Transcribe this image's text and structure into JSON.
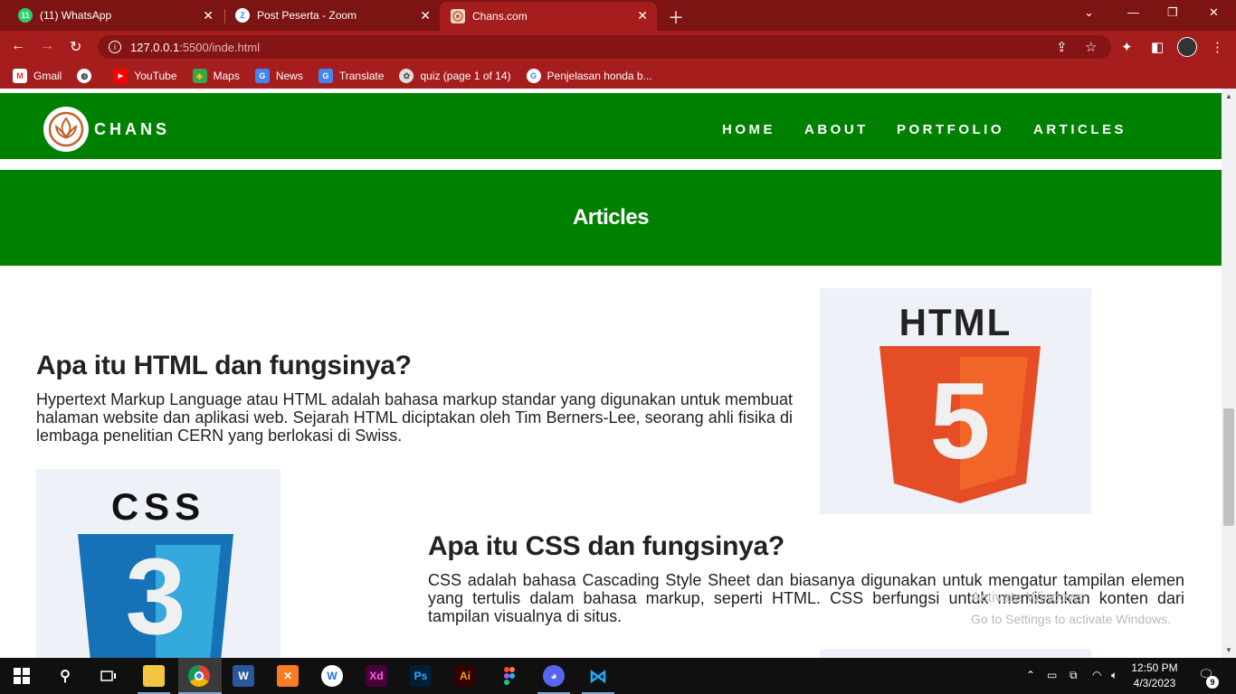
{
  "browser": {
    "tabs": [
      {
        "title": "(11) WhatsApp",
        "badge": "11"
      },
      {
        "title": "Post Peserta - Zoom",
        "icon_letter": "Z"
      },
      {
        "title": "Chans.com"
      }
    ],
    "url_host": "127.0.0.1",
    "url_path": ":5500/inde.html",
    "bookmarks": [
      {
        "label": "Gmail",
        "icon": "gmail-icon"
      },
      {
        "label": "",
        "icon": "globe-icon"
      },
      {
        "label": "YouTube",
        "icon": "youtube-icon"
      },
      {
        "label": "Maps",
        "icon": "maps-icon"
      },
      {
        "label": "News",
        "icon": "news-icon"
      },
      {
        "label": "Translate",
        "icon": "translate-icon"
      },
      {
        "label": "quiz (page 1 of 14)",
        "icon": "quiz-icon"
      },
      {
        "label": "Penjelasan honda b...",
        "icon": "google-icon"
      }
    ],
    "theme_color": "#a61d1d"
  },
  "site": {
    "brand": "CHANS",
    "menu": [
      "HOME",
      "ABOUT",
      "PORTFOLIO",
      "ARTICLES"
    ],
    "hero_title": "Articles",
    "accent_color": "#008000",
    "articles": [
      {
        "title": "Apa itu HTML dan fungsinya?",
        "text": "Hypertext Markup Language atau HTML adalah bahasa markup standar yang digunakan untuk membuat halaman website dan aplikasi web. Sejarah HTML diciptakan oleh Tim Berners-Lee, seorang ahli fisika di lembaga penelitian CERN yang berlokasi di Swiss.",
        "image_label": "HTML",
        "image_number": "5"
      },
      {
        "title": "Apa itu CSS dan fungsinya?",
        "text": "CSS adalah bahasa Cascading Style Sheet dan biasanya digunakan untuk mengatur tampilan elemen yang tertulis dalam bahasa markup, seperti HTML. CSS berfungsi untuk memisahkan konten dari tampilan visualnya di situs.",
        "image_label": "CSS",
        "image_number": "3"
      }
    ]
  },
  "watermark": {
    "line1": "Activate Windows",
    "line2": "Go to Settings to activate Windows."
  },
  "taskbar": {
    "apps": [
      "start-icon",
      "search-icon",
      "task-view-icon",
      "file-explorer-icon",
      "chrome-icon",
      "word-icon",
      "xampp-icon",
      "app-icon",
      "xd-icon",
      "photoshop-icon",
      "illustrator-icon",
      "figma-icon",
      "discord-icon",
      "vscode-icon"
    ],
    "xd_label": "Xd",
    "ps_label": "Ps",
    "ai_label": "Ai",
    "time": "12:50 PM",
    "date": "4/3/2023",
    "notifications": "9"
  }
}
